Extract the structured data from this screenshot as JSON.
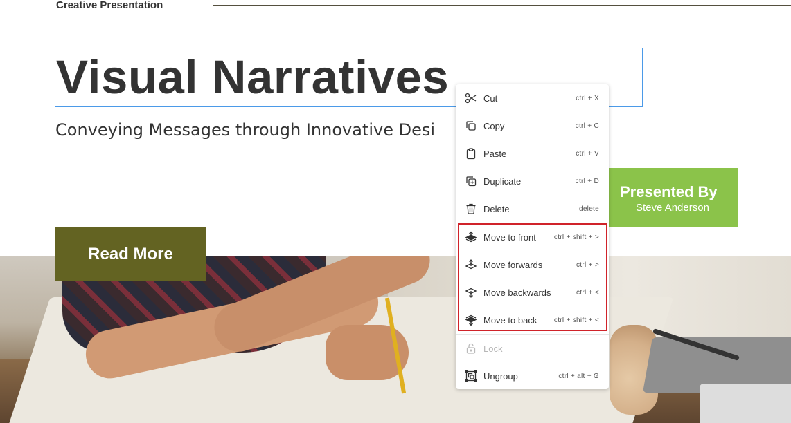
{
  "slide": {
    "label": "Creative Presentation",
    "title": "Visual Narratives",
    "subtitle": "Conveying Messages through Innovative Desi",
    "presented_by": {
      "heading": "Presented By",
      "name": "Steve Anderson"
    },
    "read_more": "Read More"
  },
  "colors": {
    "selection": "#4b9ae8",
    "presented_bg": "#8bc34a",
    "read_more_bg": "#636322",
    "highlight_border": "#d0232a"
  },
  "context_menu": {
    "items": [
      {
        "label": "Cut",
        "shortcut": "ctrl + X",
        "icon": "scissors-icon"
      },
      {
        "label": "Copy",
        "shortcut": "ctrl + C",
        "icon": "copy-icon"
      },
      {
        "label": "Paste",
        "shortcut": "ctrl + V",
        "icon": "clipboard-icon"
      },
      {
        "label": "Duplicate",
        "shortcut": "ctrl + D",
        "icon": "duplicate-icon"
      },
      {
        "label": "Delete",
        "shortcut": "delete",
        "icon": "trash-icon"
      },
      {
        "label": "Move to front",
        "shortcut": "ctrl + shift + >",
        "icon": "bring-to-front-icon"
      },
      {
        "label": "Move forwards",
        "shortcut": "ctrl + >",
        "icon": "bring-forward-icon"
      },
      {
        "label": "Move backwards",
        "shortcut": "ctrl + <",
        "icon": "send-backward-icon"
      },
      {
        "label": "Move to back",
        "shortcut": "ctrl + shift + <",
        "icon": "send-to-back-icon"
      },
      {
        "label": "Lock",
        "shortcut": "",
        "icon": "lock-icon",
        "disabled": true
      },
      {
        "label": "Ungroup",
        "shortcut": "ctrl + alt + G",
        "icon": "ungroup-icon"
      }
    ]
  }
}
